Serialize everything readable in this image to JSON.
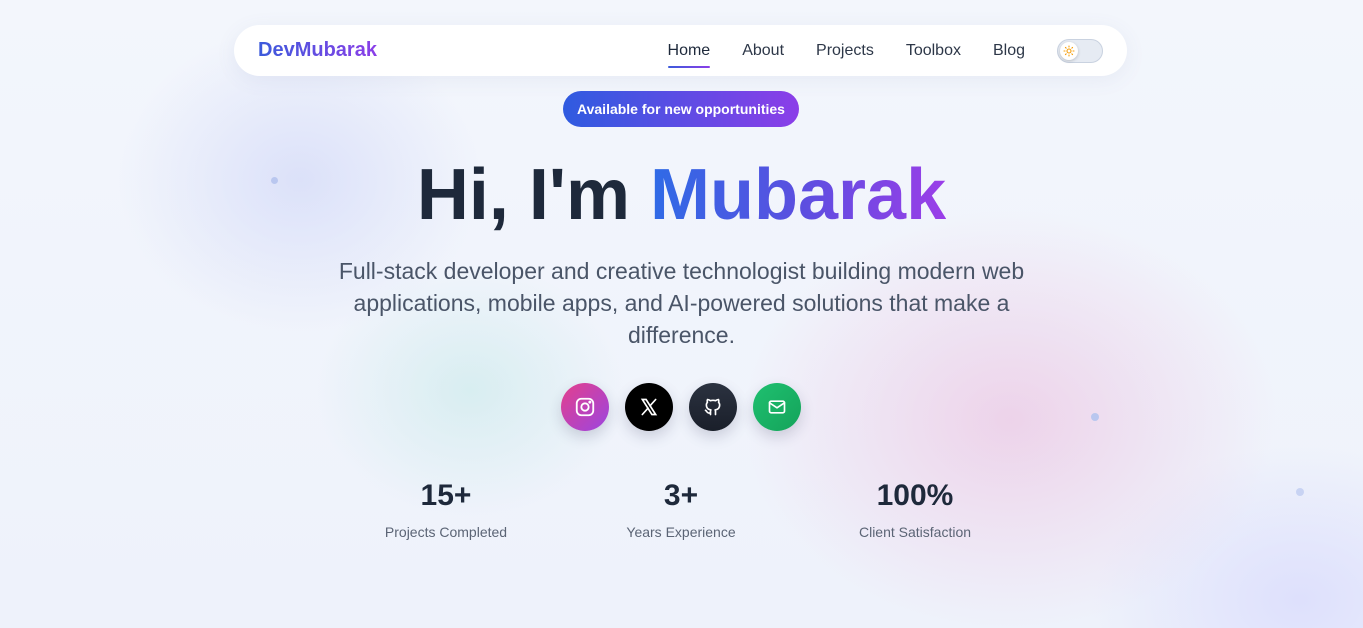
{
  "nav": {
    "brand": "DevMubarak",
    "links": [
      {
        "label": "Home",
        "active": true
      },
      {
        "label": "About",
        "active": false
      },
      {
        "label": "Projects",
        "active": false
      },
      {
        "label": "Toolbox",
        "active": false
      },
      {
        "label": "Blog",
        "active": false
      }
    ],
    "theme_toggle_icon": "sun-icon"
  },
  "badge": {
    "label": "Available for new opportunities"
  },
  "hero": {
    "greeting": "Hi, I'm ",
    "name": "Mubarak",
    "subtitle": "Full-stack developer and creative technologist building modern web applications, mobile apps, and AI-powered solutions that make a difference."
  },
  "socials": [
    {
      "name": "instagram",
      "icon": "instagram-icon"
    },
    {
      "name": "x",
      "icon": "x-icon"
    },
    {
      "name": "github",
      "icon": "github-icon"
    },
    {
      "name": "email",
      "icon": "mail-icon"
    }
  ],
  "stats": [
    {
      "value": "15+",
      "label": "Projects Completed"
    },
    {
      "value": "3+",
      "label": "Years Experience"
    },
    {
      "value": "100%",
      "label": "Client Satisfaction"
    }
  ],
  "colors": {
    "accent_start": "#2f5be0",
    "accent_end": "#8b3ee8",
    "text_dark": "#1e293b"
  }
}
